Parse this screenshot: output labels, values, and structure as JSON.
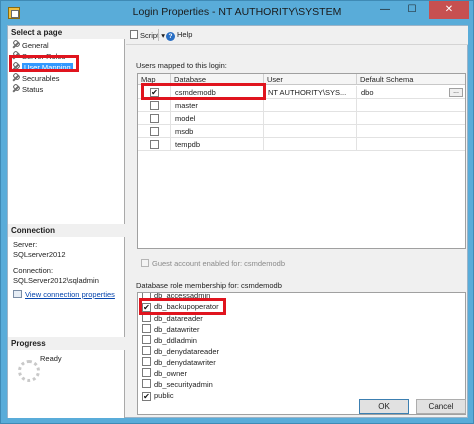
{
  "window": {
    "title": "Login Properties - NT AUTHORITY\\SYSTEM",
    "minimize": "—",
    "maximize": "☐",
    "close": "✕"
  },
  "left": {
    "select_page_header": "Select a page",
    "pages": [
      {
        "label": "General",
        "selected": false
      },
      {
        "label": "Server Roles",
        "selected": false
      },
      {
        "label": "User Mapping",
        "selected": true
      },
      {
        "label": "Securables",
        "selected": false
      },
      {
        "label": "Status",
        "selected": false
      }
    ],
    "connection_header": "Connection",
    "server_label": "Server:",
    "server_value": "SQLserver2012",
    "connection_label": "Connection:",
    "connection_value": "SQLServer2012\\sqladmin",
    "view_link": "View connection properties",
    "progress_header": "Progress",
    "progress_status": "Ready"
  },
  "toolbar": {
    "script_label": "Script",
    "help_label": "Help",
    "help_glyph": "?"
  },
  "mapping": {
    "group_label": "Users mapped to this login:",
    "columns": [
      "Map",
      "Database",
      "User",
      "Default Schema"
    ],
    "rows": [
      {
        "map": true,
        "database": "csmdemodb",
        "user": "NT AUTHORITY\\SYS...",
        "schema": "dbo",
        "has_button": true
      },
      {
        "map": false,
        "database": "master",
        "user": "",
        "schema": "",
        "has_button": false
      },
      {
        "map": false,
        "database": "model",
        "user": "",
        "schema": "",
        "has_button": false
      },
      {
        "map": false,
        "database": "msdb",
        "user": "",
        "schema": "",
        "has_button": false
      },
      {
        "map": false,
        "database": "tempdb",
        "user": "",
        "schema": "",
        "has_button": false
      }
    ],
    "ellipsis": "..."
  },
  "guest_label": "Guest account enabled for: csmdemodb",
  "roles": {
    "group_label": "Database role membership for: csmdemodb",
    "items": [
      {
        "label": "db_accessadmin",
        "checked": false
      },
      {
        "label": "db_backupoperator",
        "checked": true
      },
      {
        "label": "db_datareader",
        "checked": false
      },
      {
        "label": "db_datawriter",
        "checked": false
      },
      {
        "label": "db_ddladmin",
        "checked": false
      },
      {
        "label": "db_denydatareader",
        "checked": false
      },
      {
        "label": "db_denydatawriter",
        "checked": false
      },
      {
        "label": "db_owner",
        "checked": false
      },
      {
        "label": "db_securityadmin",
        "checked": false
      },
      {
        "label": "public",
        "checked": true
      }
    ]
  },
  "buttons": {
    "ok": "OK",
    "cancel": "Cancel"
  },
  "check_glyph": "✔",
  "colors": {
    "titlebar": "#59acd9",
    "selection": "#3399ff",
    "highlight_box": "#e0141e"
  }
}
